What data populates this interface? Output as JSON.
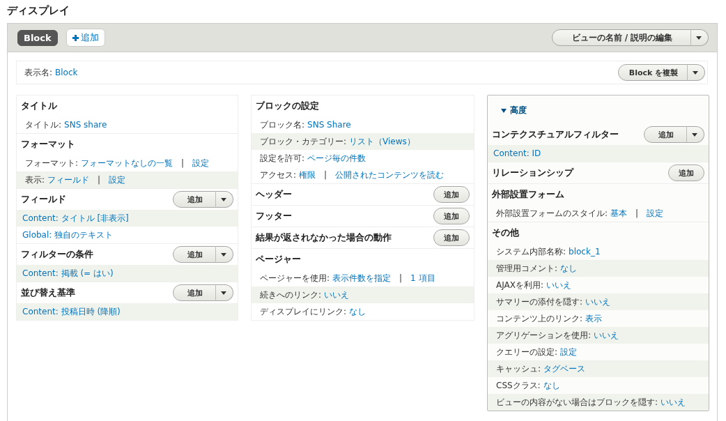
{
  "heading": "ディスプレイ",
  "tabs": [
    {
      "label": "Block",
      "selected": true
    }
  ],
  "add_display": {
    "label": "追加"
  },
  "edit_view": {
    "label": "ビューの名前 / 説明の編集"
  },
  "display_name": {
    "label": "表示名:",
    "value": "Block",
    "button": "Block を複製"
  },
  "columns": [
    {
      "sections": [
        {
          "title": "タイトル",
          "kind": "plain",
          "rows": [
            {
              "shaded": false,
              "parts": [
                {
                  "kind": "label",
                  "text": "タイトル:"
                },
                {
                  "kind": "link",
                  "text": "SNS share"
                }
              ]
            }
          ]
        },
        {
          "title": "フォーマット",
          "kind": "plain",
          "rows": [
            {
              "shaded": false,
              "parts": [
                {
                  "kind": "label",
                  "text": "フォーマット:"
                },
                {
                  "kind": "link",
                  "text": "フォーマットなしの一覧"
                },
                {
                  "kind": "sep",
                  "text": "|"
                },
                {
                  "kind": "link",
                  "text": "設定"
                }
              ]
            },
            {
              "shaded": true,
              "parts": [
                {
                  "kind": "label",
                  "text": "表示:"
                },
                {
                  "kind": "link",
                  "text": "フィールド"
                },
                {
                  "kind": "sep",
                  "text": "|"
                },
                {
                  "kind": "link",
                  "text": "設定"
                }
              ]
            }
          ]
        },
        {
          "title": "フィールド",
          "kind": "split",
          "button_label": "追加",
          "rows": [
            {
              "shaded": true,
              "parts": [
                {
                  "kind": "link",
                  "text": "Content: タイトル [非表示]"
                }
              ]
            },
            {
              "shaded": false,
              "parts": [
                {
                  "kind": "link",
                  "text": "Global: 独自のテキスト"
                }
              ]
            }
          ]
        },
        {
          "title": "フィルターの条件",
          "kind": "split",
          "button_label": "追加",
          "rows": [
            {
              "shaded": true,
              "parts": [
                {
                  "kind": "link",
                  "text": "Content: 掲載 (= はい)"
                }
              ]
            }
          ]
        },
        {
          "title": "並び替え基準",
          "kind": "split",
          "button_label": "追加",
          "rows": [
            {
              "shaded": true,
              "parts": [
                {
                  "kind": "link",
                  "text": "Content: 投稿日時 (降順)"
                }
              ]
            }
          ]
        }
      ]
    },
    {
      "sections": [
        {
          "title": "ブロックの設定",
          "kind": "plain",
          "rows": [
            {
              "shaded": false,
              "parts": [
                {
                  "kind": "label",
                  "text": "ブロック名:"
                },
                {
                  "kind": "link",
                  "text": "SNS Share"
                }
              ]
            },
            {
              "shaded": true,
              "parts": [
                {
                  "kind": "label",
                  "text": "ブロック・カテゴリー:"
                },
                {
                  "kind": "link",
                  "text": "リスト（Views）"
                }
              ]
            },
            {
              "shaded": false,
              "parts": [
                {
                  "kind": "label",
                  "text": "設定を許可:"
                },
                {
                  "kind": "link",
                  "text": "ページ毎の件数"
                }
              ]
            },
            {
              "shaded": false,
              "parts": [
                {
                  "kind": "label",
                  "text": "アクセス:"
                },
                {
                  "kind": "link",
                  "text": "権限"
                },
                {
                  "kind": "sep",
                  "text": "|"
                },
                {
                  "kind": "link",
                  "text": "公開されたコンテンツを読む"
                }
              ]
            }
          ]
        },
        {
          "title": "ヘッダー",
          "kind": "single",
          "button_label": "追加"
        },
        {
          "title": "フッター",
          "kind": "single",
          "button_label": "追加"
        },
        {
          "title": "結果が返されなかった場合の動作",
          "kind": "single",
          "button_label": "追加"
        },
        {
          "title": "ページャー",
          "kind": "plain",
          "rows": [
            {
              "shaded": false,
              "parts": [
                {
                  "kind": "label",
                  "text": "ページャーを使用:"
                },
                {
                  "kind": "link",
                  "text": "表示件数を指定"
                },
                {
                  "kind": "sep",
                  "text": "|"
                },
                {
                  "kind": "link",
                  "text": "1 項目"
                }
              ]
            },
            {
              "shaded": true,
              "parts": [
                {
                  "kind": "label",
                  "text": "続きへのリンク:"
                },
                {
                  "kind": "link",
                  "text": "いいえ"
                }
              ]
            },
            {
              "shaded": false,
              "parts": [
                {
                  "kind": "label",
                  "text": "ディスプレイにリンク:"
                },
                {
                  "kind": "link",
                  "text": "なし"
                }
              ]
            }
          ]
        }
      ]
    }
  ],
  "advanced": {
    "title": "高度",
    "expanded": true,
    "sections": [
      {
        "title": "コンテクスチュアルフィルター",
        "kind": "split",
        "button_label": "追加",
        "rows": [
          {
            "shaded": true,
            "parts": [
              {
                "kind": "link",
                "text": "Content: ID"
              }
            ]
          }
        ]
      },
      {
        "title": "リレーションシップ",
        "kind": "single",
        "button_label": "追加"
      },
      {
        "title": "外部設置フォーム",
        "kind": "plain",
        "rows": [
          {
            "shaded": false,
            "parts": [
              {
                "kind": "label",
                "text": "外部設置フォームのスタイル:"
              },
              {
                "kind": "link",
                "text": "基本"
              },
              {
                "kind": "sep",
                "text": "|"
              },
              {
                "kind": "link",
                "text": "設定"
              }
            ]
          }
        ]
      },
      {
        "title": "その他",
        "kind": "plain",
        "rows": [
          {
            "shaded": false,
            "parts": [
              {
                "kind": "label",
                "text": "システム内部名称:"
              },
              {
                "kind": "link",
                "text": "block_1"
              }
            ]
          },
          {
            "shaded": true,
            "parts": [
              {
                "kind": "label",
                "text": "管理用コメント:"
              },
              {
                "kind": "link",
                "text": "なし"
              }
            ]
          },
          {
            "shaded": false,
            "parts": [
              {
                "kind": "label",
                "text": "AJAXを利用:"
              },
              {
                "kind": "link",
                "text": "いいえ"
              }
            ]
          },
          {
            "shaded": true,
            "parts": [
              {
                "kind": "label",
                "text": "サマリーの添付を隠す:"
              },
              {
                "kind": "link",
                "text": "いいえ"
              }
            ]
          },
          {
            "shaded": false,
            "parts": [
              {
                "kind": "label",
                "text": "コンテンツ上のリンク:"
              },
              {
                "kind": "link",
                "text": "表示"
              }
            ]
          },
          {
            "shaded": true,
            "parts": [
              {
                "kind": "label",
                "text": "アグリゲーションを使用:"
              },
              {
                "kind": "link",
                "text": "いいえ"
              }
            ]
          },
          {
            "shaded": false,
            "parts": [
              {
                "kind": "label",
                "text": "クエリーの設定:"
              },
              {
                "kind": "link",
                "text": "設定"
              }
            ]
          },
          {
            "shaded": true,
            "parts": [
              {
                "kind": "label",
                "text": "キャッシュ:"
              },
              {
                "kind": "link",
                "text": "タグベース"
              }
            ]
          },
          {
            "shaded": false,
            "parts": [
              {
                "kind": "label",
                "text": "CSSクラス:"
              },
              {
                "kind": "link",
                "text": "なし"
              }
            ]
          },
          {
            "shaded": true,
            "parts": [
              {
                "kind": "label",
                "text": "ビューの内容がない場合はブロックを隠す:"
              },
              {
                "kind": "link",
                "text": "いいえ"
              }
            ]
          }
        ]
      }
    ]
  }
}
